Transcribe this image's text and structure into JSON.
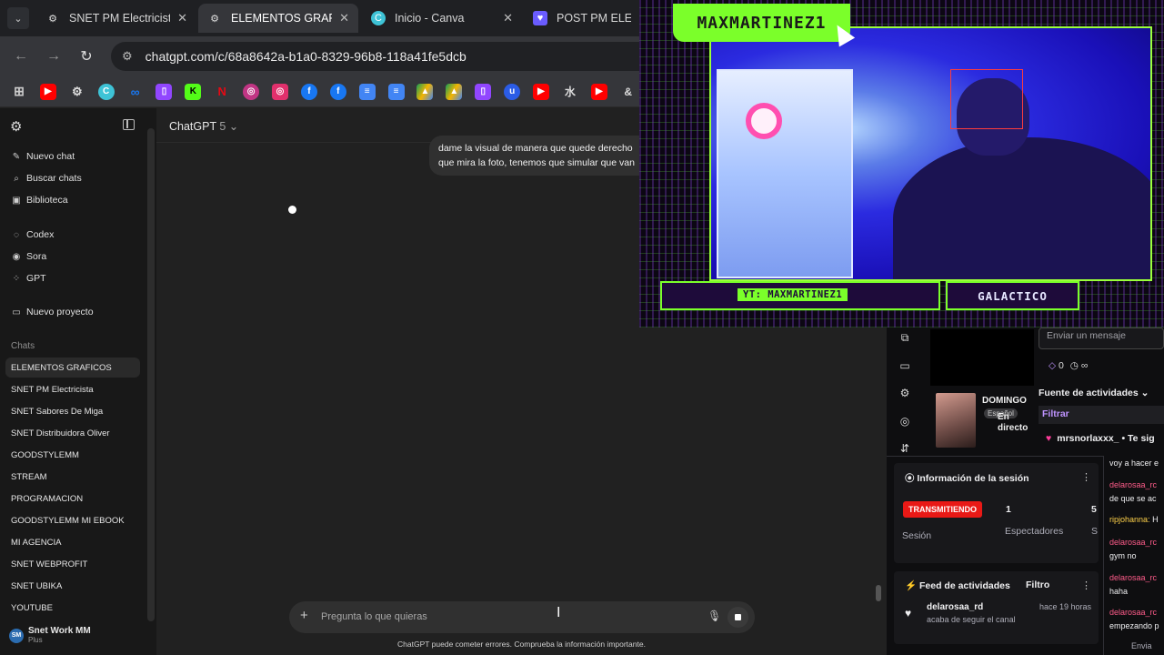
{
  "browser": {
    "tabs": [
      {
        "label": "SNET PM Electricista",
        "icon": "chatgpt-icon"
      },
      {
        "label": "ELEMENTOS GRAFIC",
        "icon": "chatgpt-icon",
        "active": true
      },
      {
        "label": "Inicio - Canva",
        "icon": "canva-icon"
      },
      {
        "label": "POST PM ELECTRE",
        "icon": "heart-icon"
      }
    ],
    "url": "chatgpt.com/c/68a8642a-b1a0-8329-96b8-118a41fe5dcb",
    "bookmarks": [
      "apps-icon",
      "youtube-icon",
      "chatgpt-icon",
      "canva-icon",
      "meta-icon",
      "twitch-icon",
      "kick-icon",
      "netflix-icon",
      "instagram-color-icon",
      "instagram-icon",
      "facebook-icon",
      "facebook-icon",
      "docs-icon",
      "docs-icon",
      "drive-icon",
      "drive-icon",
      "twitch-icon",
      "upwork-icon",
      "youtube-icon",
      "youtube-icon"
    ]
  },
  "sidebar": {
    "top_items": [
      {
        "label": "Nuevo chat",
        "icon": "edit-icon"
      },
      {
        "label": "Buscar chats",
        "icon": "search-icon"
      },
      {
        "label": "Biblioteca",
        "icon": "library-icon"
      }
    ],
    "tool_items": [
      {
        "label": "Codex",
        "icon": "codex-icon"
      },
      {
        "label": "Sora",
        "icon": "sora-icon"
      },
      {
        "label": "GPT",
        "icon": "gpt-icon"
      }
    ],
    "project_item": {
      "label": "Nuevo proyecto",
      "icon": "folder-icon"
    },
    "chats_heading": "Chats",
    "chats": [
      "ELEMENTOS GRAFICOS",
      "SNET PM Electricista",
      "SNET Sabores De Miga",
      "SNET Distribuidora Oliver",
      "GOODSTYLEMM",
      "STREAM",
      "PROGRAMACION",
      "GOODSTYLEMM MI EBOOK",
      "MI AGENCIA",
      "SNET WEBPROFIT",
      "SNET UBIKA",
      "YOUTUBE"
    ],
    "active_chat": 0,
    "user": {
      "initials": "SM",
      "name": "Snet Work MM",
      "plan": "Plus"
    }
  },
  "main": {
    "model": "ChatGPT",
    "model_version": "5",
    "message_line1": "dame la visual de manera que quede derecho",
    "message_line2": "que mira la foto, tenemos que simular que van",
    "composer_placeholder": "Pregunta lo que quieras",
    "disclaimer": "ChatGPT puede cometer errores. Comprueba la información importante."
  },
  "overlay": {
    "streamer": "MAXMARTINEZ1",
    "yt_tag": "YT: MAXMARTINEZ1",
    "category": "GALACTICO",
    "accent": "#7bff2a"
  },
  "twitch": {
    "message_placeholder": "Enviar un mensaje",
    "points": "0",
    "points_extra": "∞",
    "activity_heading": "Fuente de actividades",
    "filter": "Filtrar",
    "follower": "mrsnorlaxxx_",
    "follower_action": "• Te sig",
    "thumb_title": "DOMINGO",
    "thumb_lang": "Español",
    "thumb_status_1": "En",
    "thumb_status_2": "directo",
    "session_title": "Información de la sesión",
    "live_badge": "TRANSMITIENDO",
    "session_label": "Sesión",
    "viewers_value": "1",
    "viewers_label": "Espectadores",
    "extra_value": "5",
    "extra_label": "S",
    "feed_title": "Feed de actividades",
    "feed_filter": "Filtro",
    "activity_user": "delarosaa_rd",
    "activity_time": "hace 19 horas",
    "activity_desc": "acaba de seguir el canal",
    "chat_lines": [
      {
        "user": "",
        "text": "voy a hacer e"
      },
      {
        "user": "delarosaa_rc",
        "text": ""
      },
      {
        "user": "",
        "text": "de que se ac"
      },
      {
        "user": "ripjohanna:",
        "text": "H"
      },
      {
        "user": "delarosaa_rc",
        "text": ""
      },
      {
        "user": "",
        "text": "gym no"
      },
      {
        "user": "delarosaa_rc",
        "text": ""
      },
      {
        "user": "",
        "text": "haha"
      },
      {
        "user": "delarosaa_rc",
        "text": ""
      },
      {
        "user": "",
        "text": "empezando p"
      },
      {
        "user": "",
        "text": "Envia"
      }
    ],
    "live_color": "#e91916"
  }
}
